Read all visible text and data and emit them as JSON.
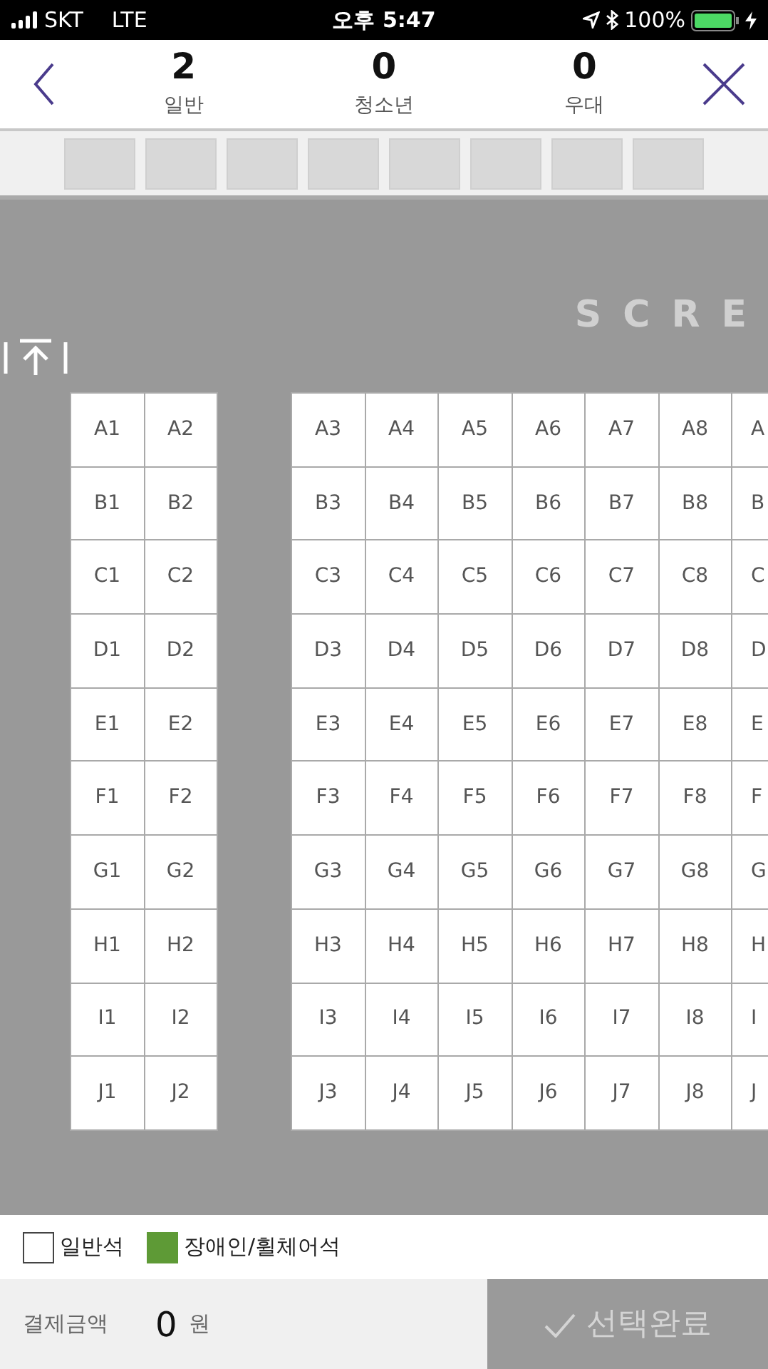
{
  "status_bar": {
    "carrier": "SKT",
    "network": "LTE",
    "time": "오후 5:47",
    "battery": "100%"
  },
  "header": {
    "counts": [
      {
        "count": "2",
        "label": "일반"
      },
      {
        "count": "0",
        "label": "청소년"
      },
      {
        "count": "0",
        "label": "우대"
      }
    ]
  },
  "minimap": [
    {
      "kind": "block"
    },
    {
      "kind": "block"
    },
    {
      "kind": "block"
    },
    {
      "kind": "block"
    },
    {
      "kind": "block"
    },
    {
      "kind": "block"
    },
    {
      "kind": "block"
    },
    {
      "kind": "block"
    }
  ],
  "seat_map": {
    "screen_label": "SCRE",
    "left_block": [
      [
        "A1",
        "A2"
      ],
      [
        "B1",
        "B2"
      ],
      [
        "C1",
        "C2"
      ],
      [
        "D1",
        "D2"
      ],
      [
        "E1",
        "E2"
      ],
      [
        "F1",
        "F2"
      ],
      [
        "G1",
        "G2"
      ],
      [
        "H1",
        "H2"
      ],
      [
        "I1",
        "I2"
      ],
      [
        "J1",
        "J2"
      ]
    ],
    "right_block": [
      [
        "A3",
        "A4",
        "A5",
        "A6",
        "A7",
        "A8",
        "A"
      ],
      [
        "B3",
        "B4",
        "B5",
        "B6",
        "B7",
        "B8",
        "B"
      ],
      [
        "C3",
        "C4",
        "C5",
        "C6",
        "C7",
        "C8",
        "C"
      ],
      [
        "D3",
        "D4",
        "D5",
        "D6",
        "D7",
        "D8",
        "D"
      ],
      [
        "E3",
        "E4",
        "E5",
        "E6",
        "E7",
        "E8",
        "E"
      ],
      [
        "F3",
        "F4",
        "F5",
        "F6",
        "F7",
        "F8",
        "F"
      ],
      [
        "G3",
        "G4",
        "G5",
        "G6",
        "G7",
        "G8",
        "G"
      ],
      [
        "H3",
        "H4",
        "H5",
        "H6",
        "H7",
        "H8",
        "H"
      ],
      [
        "I3",
        "I4",
        "I5",
        "I6",
        "I7",
        "I8",
        "I"
      ],
      [
        "J3",
        "J4",
        "J5",
        "J6",
        "J7",
        "J8",
        "J"
      ]
    ]
  },
  "legend": [
    {
      "label": "일반석",
      "color": "#ffffff"
    },
    {
      "label": "장애인/휠체어석",
      "color": "#5e9a36"
    }
  ],
  "footer": {
    "label": "결제금액",
    "amount": "0",
    "unit": "원",
    "button": {
      "label": "선택완료",
      "disabled": true
    }
  }
}
